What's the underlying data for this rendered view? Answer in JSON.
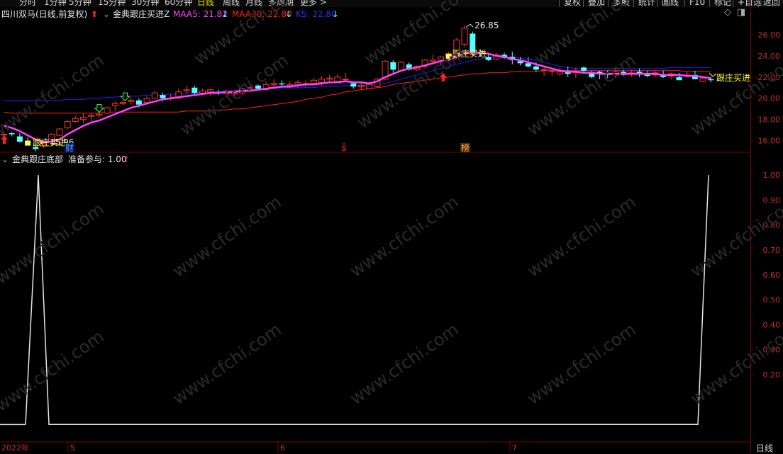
{
  "toolbar": {
    "periods": [
      "分时",
      "1分钟",
      "5分钟",
      "15分钟",
      "30分钟",
      "60分钟",
      "日线",
      "周线",
      "月线",
      "多周期",
      "更多 >"
    ],
    "active_period": "日线",
    "right_buttons": [
      "复权",
      "叠加",
      "多股",
      "统计",
      "画线",
      "F10",
      "标记",
      "+自选",
      "返回"
    ]
  },
  "main_info": {
    "stock_name": "四川双马(日线,前复权)",
    "indicator_name": "金典跟庄买进Z",
    "maa5_label": "MAA5: 21.82",
    "maa30_label": "MAA30: 22.80",
    "ks_label": "KS: 22.80",
    "arrow_down": "↓"
  },
  "sub_info": {
    "indicator_name": "金典跟庄底部",
    "value_label": "准备参与: 1.00",
    "arrow_up": "↑"
  },
  "annotations": {
    "high_price": "26.85",
    "low_price": "15.96",
    "buy_signal": "跟庄买进",
    "marker_cai": "财",
    "marker_s": "ŝ",
    "marker_bang": "榜"
  },
  "bottom": {
    "period_label": "日线",
    "date_labels": [
      "2022年",
      "5",
      "6",
      "7"
    ]
  },
  "watermark": "www.cfchi.com",
  "colors": {
    "up": "#ff3232",
    "down": "#54ffff",
    "maa5": "#ff40ff",
    "maa30": "#ff2020",
    "ks": "#2020ff",
    "grid": "#7a0000",
    "axis_text": "#c03030",
    "signal": "#ffff40"
  },
  "chart_data": {
    "type": "candlestick",
    "title": "",
    "main_ylim": [
      14.9,
      27.2
    ],
    "main_yticks": [
      16.0,
      18.0,
      20.0,
      22.0,
      24.0,
      26.0
    ],
    "sub_ylim": [
      -0.07,
      1.04
    ],
    "sub_yticks": [
      0.2,
      0.3,
      0.4,
      0.5,
      0.6,
      0.7,
      0.8,
      0.9,
      1.0
    ],
    "candles": [
      [
        16.6,
        16.9,
        16.1,
        16.6
      ],
      [
        16.7,
        16.8,
        16.4,
        16.6
      ],
      [
        16.4,
        16.7,
        15.8,
        15.9
      ],
      [
        16.0,
        16.3,
        15.7,
        15.8
      ],
      [
        15.4,
        15.6,
        15.0,
        15.2
      ],
      [
        15.5,
        15.8,
        15.3,
        15.7
      ],
      [
        15.9,
        16.7,
        15.9,
        16.6
      ],
      [
        16.5,
        17.2,
        16.4,
        17.1
      ],
      [
        17.2,
        17.9,
        17.1,
        17.8
      ],
      [
        17.8,
        18.3,
        17.7,
        18.1
      ],
      [
        18.0,
        18.6,
        17.7,
        18.2
      ],
      [
        18.3,
        18.6,
        17.8,
        18.4
      ],
      [
        18.4,
        18.7,
        18.2,
        18.5
      ],
      [
        18.6,
        19.2,
        18.5,
        19.1
      ],
      [
        19.3,
        19.7,
        18.8,
        19.5
      ],
      [
        19.5,
        19.9,
        19.3,
        19.6
      ],
      [
        19.7,
        20.1,
        19.4,
        19.8
      ],
      [
        19.8,
        20.0,
        19.1,
        19.4
      ],
      [
        19.6,
        20.2,
        19.4,
        20.0
      ],
      [
        20.0,
        20.7,
        20.0,
        20.5
      ],
      [
        20.3,
        20.5,
        19.7,
        20.0
      ],
      [
        20.0,
        20.4,
        19.8,
        20.0
      ],
      [
        20.0,
        20.9,
        20.0,
        20.6
      ],
      [
        20.7,
        21.2,
        20.4,
        20.8
      ],
      [
        21.0,
        21.2,
        20.3,
        20.5
      ],
      [
        20.5,
        20.9,
        20.3,
        20.7
      ],
      [
        20.6,
        20.9,
        20.2,
        20.8
      ],
      [
        20.6,
        20.8,
        20.3,
        20.5
      ],
      [
        20.5,
        20.8,
        20.2,
        20.5
      ],
      [
        20.4,
        20.8,
        20.2,
        20.5
      ],
      [
        20.5,
        21.0,
        20.3,
        20.9
      ],
      [
        20.9,
        21.2,
        20.6,
        21.0
      ],
      [
        21.2,
        21.3,
        20.8,
        20.9
      ],
      [
        20.8,
        21.6,
        20.7,
        21.3
      ],
      [
        21.3,
        21.8,
        21.0,
        21.4
      ],
      [
        21.4,
        21.7,
        21.1,
        21.3
      ],
      [
        21.2,
        21.6,
        21.0,
        21.3
      ],
      [
        21.3,
        21.7,
        21.0,
        21.5
      ],
      [
        21.4,
        21.7,
        21.0,
        21.4
      ],
      [
        21.4,
        21.9,
        21.2,
        21.7
      ],
      [
        21.5,
        22.1,
        21.2,
        21.8
      ],
      [
        21.8,
        22.2,
        21.5,
        21.9
      ],
      [
        21.6,
        22.3,
        21.5,
        22.0
      ],
      [
        21.8,
        22.4,
        21.6,
        21.8
      ],
      [
        21.4,
        21.5,
        20.9,
        21.1
      ],
      [
        21.1,
        21.4,
        20.8,
        21.2
      ],
      [
        20.9,
        21.6,
        20.8,
        21.3
      ],
      [
        21.1,
        21.9,
        21.0,
        21.8
      ],
      [
        21.8,
        23.6,
        21.7,
        23.5
      ],
      [
        23.4,
        23.6,
        22.3,
        22.7
      ],
      [
        22.6,
        23.5,
        22.5,
        23.4
      ],
      [
        23.2,
        23.4,
        22.6,
        22.7
      ],
      [
        22.7,
        23.1,
        22.6,
        23.0
      ],
      [
        23.0,
        23.7,
        22.8,
        23.6
      ],
      [
        23.5,
        24.1,
        23.2,
        23.6
      ],
      [
        23.6,
        24.0,
        23.1,
        23.9
      ],
      [
        23.9,
        24.4,
        23.4,
        24.2
      ],
      [
        24.2,
        25.7,
        23.7,
        25.5
      ],
      [
        25.1,
        26.85,
        24.8,
        26.6
      ],
      [
        26.1,
        26.3,
        24.0,
        24.3
      ],
      [
        24.3,
        24.6,
        24.0,
        24.2
      ],
      [
        23.9,
        24.2,
        23.5,
        23.6
      ],
      [
        23.7,
        24.3,
        23.6,
        24.1
      ],
      [
        24.1,
        24.3,
        23.7,
        23.8
      ],
      [
        23.9,
        24.4,
        23.2,
        23.6
      ],
      [
        23.5,
        23.9,
        23.1,
        23.3
      ],
      [
        23.3,
        23.9,
        22.9,
        23.0
      ],
      [
        23.0,
        23.4,
        22.5,
        22.7
      ],
      [
        22.7,
        23.0,
        22.1,
        22.7
      ],
      [
        22.6,
        22.8,
        22.1,
        22.6
      ],
      [
        22.3,
        22.9,
        22.1,
        22.5
      ],
      [
        22.6,
        23.0,
        22.0,
        22.3
      ],
      [
        22.5,
        22.9,
        21.9,
        22.5
      ],
      [
        22.9,
        23.0,
        22.3,
        22.6
      ],
      [
        22.4,
        22.6,
        21.9,
        22.0
      ],
      [
        22.5,
        22.6,
        21.8,
        22.3
      ],
      [
        22.3,
        22.6,
        21.9,
        22.2
      ],
      [
        22.3,
        22.9,
        21.9,
        22.5
      ],
      [
        22.5,
        22.7,
        22.1,
        22.2
      ],
      [
        22.3,
        22.7,
        22.0,
        22.4
      ],
      [
        22.5,
        22.8,
        22.0,
        22.3
      ],
      [
        22.3,
        22.6,
        22.0,
        22.1
      ],
      [
        22.2,
        22.6,
        22.0,
        22.4
      ],
      [
        22.2,
        22.6,
        21.9,
        22.0
      ],
      [
        22.1,
        22.4,
        21.8,
        22.3
      ],
      [
        22.0,
        22.4,
        21.8,
        21.7
      ],
      [
        22.2,
        22.5,
        22.0,
        22.2
      ],
      [
        22.2,
        22.6,
        21.8,
        21.8
      ],
      [
        21.6,
        22.0,
        21.5,
        21.9
      ],
      [
        21.8,
        22.0,
        21.5,
        21.7
      ]
    ],
    "maa5": [
      17.4,
      17.2,
      16.9,
      16.5,
      16.1,
      15.9,
      15.9,
      16.1,
      16.6,
      17.0,
      17.4,
      17.7,
      17.9,
      18.2,
      18.5,
      18.8,
      19.1,
      19.3,
      19.5,
      19.7,
      19.9,
      20.0,
      20.1,
      20.2,
      20.3,
      20.4,
      20.5,
      20.5,
      20.6,
      20.6,
      20.7,
      20.7,
      20.8,
      20.9,
      21.0,
      21.1,
      21.1,
      21.2,
      21.3,
      21.3,
      21.4,
      21.5,
      21.5,
      21.6,
      21.5,
      21.5,
      21.4,
      21.6,
      22.0,
      22.3,
      22.6,
      22.8,
      22.9,
      23.1,
      23.3,
      23.5,
      23.6,
      23.9,
      24.3,
      24.3,
      24.3,
      24.2,
      24.0,
      23.9,
      23.7,
      23.6,
      23.4,
      23.2,
      23.0,
      22.8,
      22.6,
      22.5,
      22.5,
      22.4,
      22.4,
      22.3,
      22.3,
      22.3,
      22.3,
      22.3,
      22.3,
      22.3,
      22.3,
      22.2,
      22.2,
      22.2,
      22.1,
      22.1,
      22.0,
      21.9
    ],
    "maa30": [
      18.7,
      18.6,
      18.6,
      18.6,
      18.6,
      18.6,
      18.6,
      18.6,
      18.6,
      18.6,
      18.6,
      18.6,
      18.6,
      18.7,
      18.7,
      18.7,
      18.7,
      18.7,
      18.7,
      18.7,
      18.7,
      18.7,
      18.7,
      18.8,
      18.8,
      18.8,
      18.8,
      18.9,
      18.9,
      19.0,
      19.0,
      19.1,
      19.2,
      19.3,
      19.4,
      19.5,
      19.6,
      19.7,
      19.9,
      20.0,
      20.1,
      20.3,
      20.4,
      20.6,
      20.7,
      20.8,
      20.9,
      21.0,
      21.1,
      21.3,
      21.4,
      21.5,
      21.6,
      21.7,
      21.8,
      21.9,
      22.0,
      22.1,
      22.2,
      22.3,
      22.3,
      22.4,
      22.4,
      22.4,
      22.5,
      22.5,
      22.5,
      22.5,
      22.6,
      22.6,
      22.6,
      22.6,
      22.6,
      22.6,
      22.6,
      22.6,
      22.6,
      22.6,
      22.6,
      22.6,
      22.6,
      22.6,
      22.6,
      22.6,
      22.6,
      22.6,
      22.5,
      22.5,
      22.5,
      22.5
    ],
    "ks": [
      19.8,
      19.8,
      19.8,
      19.8,
      19.8,
      19.8,
      19.8,
      19.8,
      19.9,
      19.9,
      19.9,
      20.0,
      20.0,
      20.1,
      20.1,
      20.2,
      20.2,
      20.2,
      20.3,
      20.3,
      20.3,
      20.4,
      20.4,
      20.5,
      20.5,
      20.6,
      20.6,
      20.6,
      20.7,
      20.7,
      20.8,
      20.8,
      20.8,
      20.9,
      20.9,
      21.0,
      21.0,
      21.0,
      21.0,
      21.0,
      21.1,
      21.1,
      21.1,
      21.2,
      21.2,
      21.2,
      21.2,
      21.3,
      21.4,
      21.6,
      21.8,
      22.0,
      22.2,
      22.4,
      22.6,
      22.8,
      23.0,
      23.2,
      23.4,
      23.6,
      23.7,
      23.8,
      23.9,
      23.9,
      23.9,
      23.8,
      23.7,
      23.6,
      23.4,
      23.2,
      23.0,
      22.9,
      22.8,
      22.8,
      22.8,
      22.8,
      22.8,
      22.8,
      22.8,
      22.8,
      22.8,
      22.8,
      22.8,
      22.8,
      22.9,
      22.9,
      22.9,
      22.9,
      22.9,
      22.9
    ],
    "sub_series": [
      0,
      0,
      0,
      1,
      0,
      0,
      0,
      0,
      0,
      0,
      0,
      0,
      0,
      0,
      0,
      0,
      0,
      0,
      0,
      0,
      0,
      0,
      0,
      0,
      0,
      0,
      0,
      0,
      0,
      0,
      0,
      0,
      0,
      0,
      0,
      0,
      0,
      0,
      0,
      0,
      0,
      0,
      0,
      0,
      0,
      0,
      0,
      0,
      0,
      0,
      0,
      0,
      0,
      0,
      0,
      0,
      0,
      0,
      0,
      0,
      0,
      0,
      0,
      0,
      0,
      0,
      0,
      0,
      0,
      0,
      0,
      0,
      0,
      0,
      0,
      0,
      0,
      0,
      0,
      0,
      0,
      0,
      0,
      0,
      0,
      0,
      0,
      0,
      0,
      1
    ],
    "buy_arrow_idx": [
      0,
      52
    ],
    "green_arrow_idx": [
      12,
      15
    ],
    "signal_box_idx": [
      3,
      56
    ]
  }
}
